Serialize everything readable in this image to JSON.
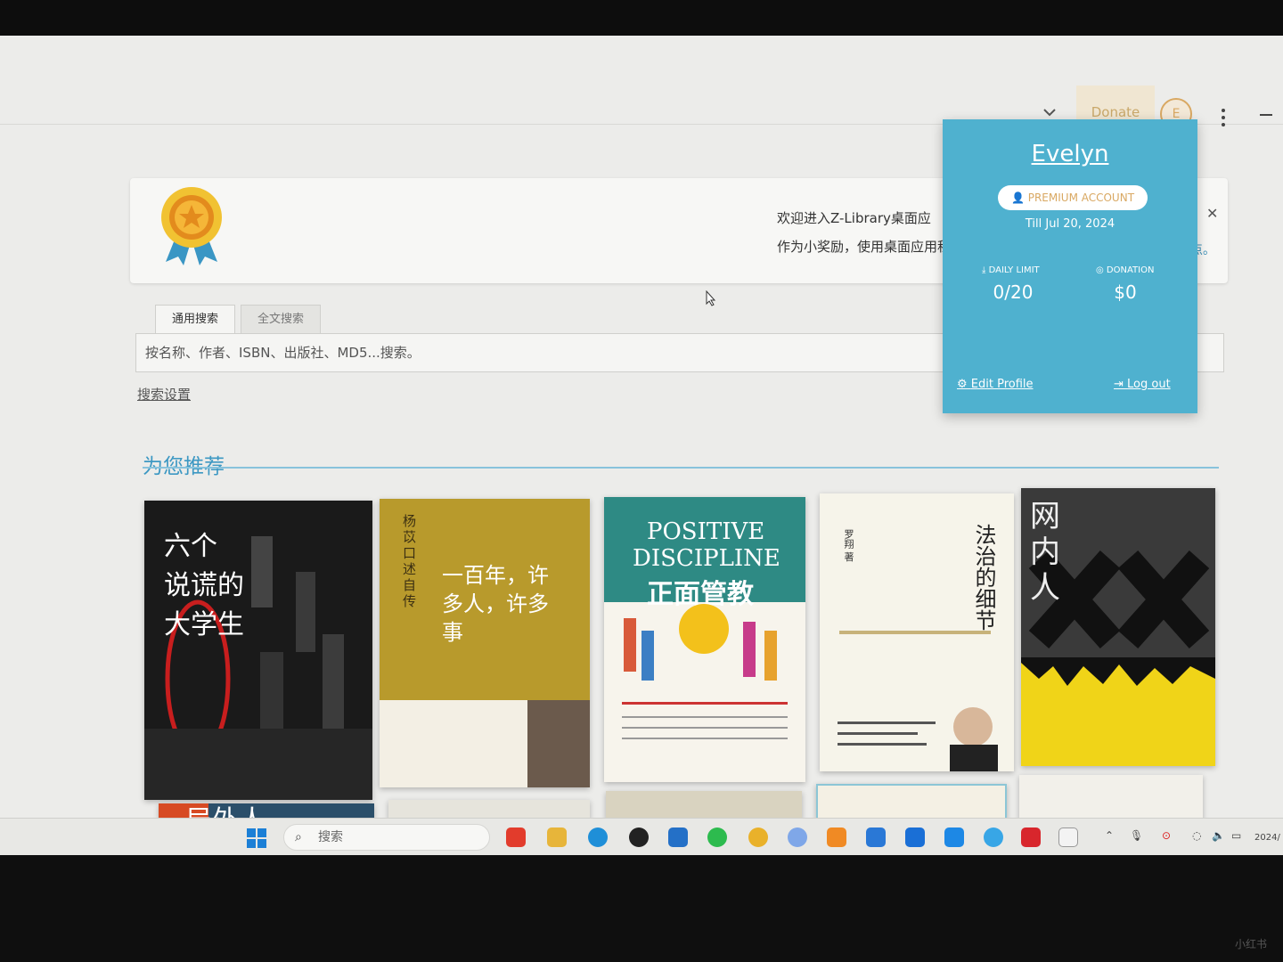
{
  "header": {
    "donate_label": "Donate",
    "avatar_initial": "E"
  },
  "banner": {
    "line1": "欢迎进入Z-Library桌面应",
    "line2": "作为小奖励，使用桌面应用程",
    "link_fragment": "点。"
  },
  "search": {
    "tabs": [
      "通用搜索",
      "全文搜索"
    ],
    "placeholder": "按名称、作者、ISBN、出版社、MD5...搜索。",
    "settings_label": "搜索设置"
  },
  "recommendations": {
    "title": "为您推荐",
    "books": [
      {
        "title": "六个说谎的大学生",
        "lines": [
          "六个",
          "说谎的",
          "大学生"
        ]
      },
      {
        "title": "杨苡口述自传 一百年，许多人，许多事",
        "vertical": "杨苡口述自传",
        "main": "一百年，许多人，许多事"
      },
      {
        "title": "POSITIVE DISCIPLINE 正面管教",
        "en1": "POSITIVE",
        "en2": "DISCIPLINE",
        "cn": "正面管教"
      },
      {
        "title": "法治的细节",
        "cn": "法治的细节",
        "author": "罗翔 著"
      },
      {
        "title": "网内人",
        "cn": "网内人"
      }
    ],
    "row2_visible_title": "局外人"
  },
  "profile": {
    "name": "Evelyn",
    "badge": "PREMIUM ACCOUNT",
    "till": "Till Jul 20, 2024",
    "daily_limit_label": "DAILY LIMIT",
    "daily_limit_value": "0/20",
    "donation_label": "DONATION",
    "donation_value": "$0",
    "edit_profile": "Edit Profile",
    "log_out": "Log out"
  },
  "taskbar": {
    "search_label": "搜索",
    "date_fragment": "2024/"
  },
  "colors": {
    "accent": "#4fb1cf",
    "premium_gold": "#d9a862",
    "link_blue": "#3d98c3"
  }
}
